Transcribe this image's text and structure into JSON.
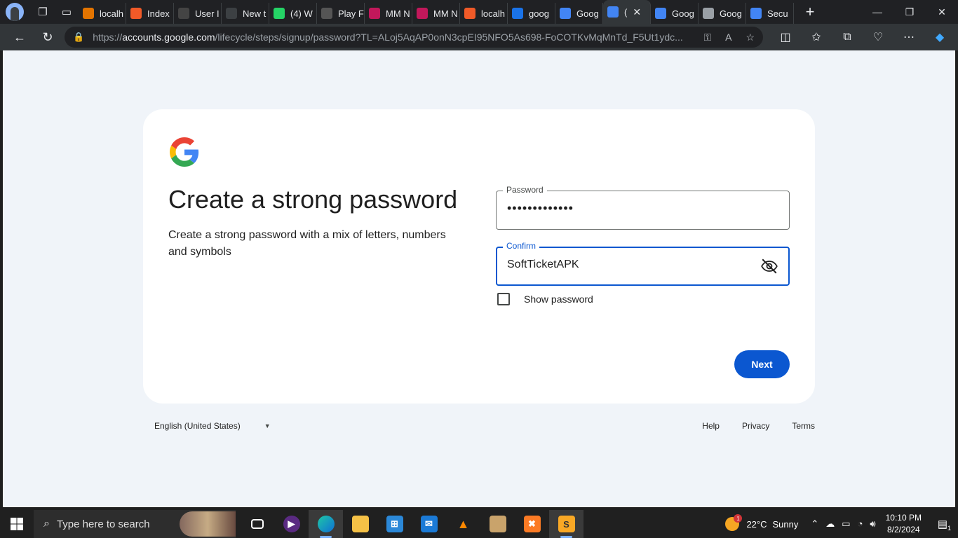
{
  "browser": {
    "tabs": [
      {
        "label": "localh",
        "color": "#e37400"
      },
      {
        "label": "Index",
        "color": "#f05a28"
      },
      {
        "label": "User I",
        "color": "#444444"
      },
      {
        "label": "New t",
        "color": "#3c4043"
      },
      {
        "label": "(4) W",
        "color": "#25d366"
      },
      {
        "label": "Play F",
        "color": "#555555"
      },
      {
        "label": "MM N",
        "color": "#c2185b"
      },
      {
        "label": "MM N",
        "color": "#c2185b"
      },
      {
        "label": "localh",
        "color": "#f05a28"
      },
      {
        "label": "goog",
        "color": "#1a73e8"
      },
      {
        "label": "Goog",
        "color": "#4285f4"
      },
      {
        "label": "(",
        "color": "#4285f4"
      },
      {
        "label": "Goog",
        "color": "#4285f4"
      },
      {
        "label": "Goog",
        "color": "#9aa0a6"
      },
      {
        "label": "Secu",
        "color": "#4285f4"
      }
    ],
    "new_tab_label": "+",
    "url_prefix": "https://",
    "url_domain": "accounts.google.com",
    "url_path": "/lifecycle/steps/signup/password?TL=ALoj5AqAP0onN3cpEI95NFO5As698-FoCOTKvMqMnTd_F5Ut1ydc..."
  },
  "page": {
    "title": "Create a strong password",
    "subtitle": "Create a strong password with a mix of letters, numbers and symbols",
    "password_label": "Password",
    "password_value": "•••••••••••••",
    "confirm_label": "Confirm",
    "confirm_value": "SoftTicketAPK",
    "show_password_label": "Show password",
    "next_label": "Next",
    "footer": {
      "language": "English (United States)",
      "help": "Help",
      "privacy": "Privacy",
      "terms": "Terms"
    }
  },
  "taskbar": {
    "search_placeholder": "Type here to search",
    "weather_temp": "22°C",
    "weather_text": "Sunny",
    "weather_badge": "1",
    "time": "10:10 PM",
    "date": "8/2/2024",
    "notification_count": "1"
  },
  "colors": {
    "accent": "#0b57d0",
    "page_bg": "#f0f4f9"
  }
}
